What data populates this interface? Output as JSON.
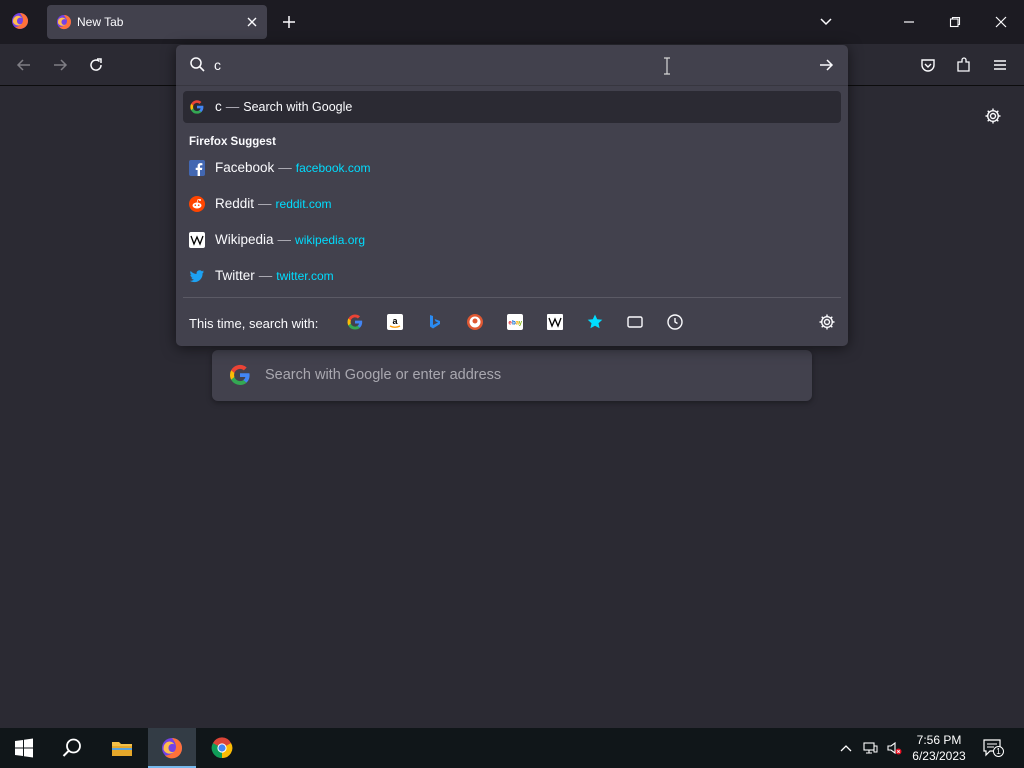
{
  "tabs": [
    {
      "title": "New Tab",
      "active": true
    }
  ],
  "urlbar": {
    "value": "c",
    "placeholder": ""
  },
  "results": {
    "top": {
      "query": "c",
      "action": "Search with Google",
      "icon": "google-icon"
    },
    "group_label": "Firefox Suggest",
    "suggestions": [
      {
        "title": "Facebook",
        "url": "facebook.com",
        "icon": "facebook-icon"
      },
      {
        "title": "Reddit",
        "url": "reddit.com",
        "icon": "reddit-icon"
      },
      {
        "title": "Wikipedia",
        "url": "wikipedia.org",
        "icon": "wikipedia-icon"
      },
      {
        "title": "Twitter",
        "url": "twitter.com",
        "icon": "twitter-icon"
      }
    ],
    "dash": "—"
  },
  "one_offs": {
    "label": "This time, search with:",
    "engines": [
      "google",
      "amazon",
      "bing",
      "duckduckgo",
      "ebay",
      "wikipedia",
      "bookmarks",
      "tabs",
      "history"
    ]
  },
  "content_search": {
    "placeholder": "Search with Google or enter address"
  },
  "taskbar": {
    "time": "7:56 PM",
    "date": "6/23/2023",
    "notification_count": "1"
  },
  "colors": {
    "background": "#2b2a33",
    "popup": "#42414d",
    "url_accent": "#00ddff",
    "taskbar": "#101619"
  }
}
